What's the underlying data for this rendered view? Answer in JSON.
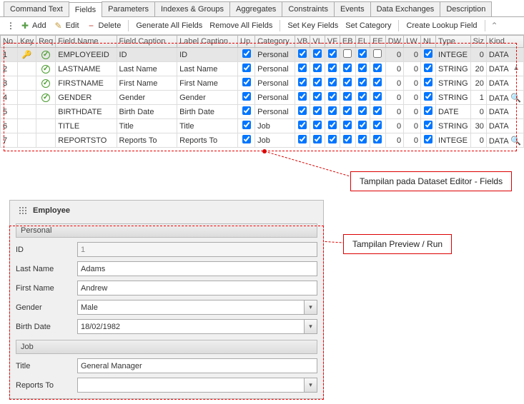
{
  "tabs": [
    "Command Text",
    "Fields",
    "Parameters",
    "Indexes & Groups",
    "Aggregates",
    "Constraints",
    "Events",
    "Data Exchanges",
    "Description"
  ],
  "active_tab": 1,
  "toolbar": {
    "add": "Add",
    "edit": "Edit",
    "delete": "Delete",
    "gen_all": "Generate All Fields",
    "rem_all": "Remove All Fields",
    "set_key": "Set Key Fields",
    "set_cat": "Set Category",
    "lookup": "Create Lookup Field"
  },
  "headers": [
    "No.",
    "Key",
    "Req",
    "Field Name",
    "Field Caption",
    "Label Caption",
    "Up.",
    "Category",
    "VB",
    "VL",
    "VF",
    "EB",
    "EL",
    "EE",
    "DW",
    "LW",
    "NL",
    "Type",
    "Siz",
    "Kind"
  ],
  "rows": [
    {
      "no": "1",
      "key": true,
      "req": true,
      "name": "EMPLOYEEID",
      "fcap": "ID",
      "lcap": "ID",
      "up": true,
      "cat": "Personal",
      "vb": true,
      "vl": true,
      "vf": true,
      "eb": false,
      "el": true,
      "ee": false,
      "dw": "0",
      "lw": "0",
      "nl": true,
      "type": "INTEGE",
      "siz": "0",
      "kind": "DATA",
      "sel": true
    },
    {
      "no": "2",
      "key": false,
      "req": true,
      "name": "LASTNAME",
      "fcap": "Last Name",
      "lcap": "Last Name",
      "up": true,
      "cat": "Personal",
      "vb": true,
      "vl": true,
      "vf": true,
      "eb": true,
      "el": true,
      "ee": true,
      "dw": "0",
      "lw": "0",
      "nl": true,
      "type": "STRING",
      "siz": "20",
      "kind": "DATA"
    },
    {
      "no": "3",
      "key": false,
      "req": true,
      "name": "FIRSTNAME",
      "fcap": "First Name",
      "lcap": "First Name",
      "up": true,
      "cat": "Personal",
      "vb": true,
      "vl": true,
      "vf": true,
      "eb": true,
      "el": true,
      "ee": true,
      "dw": "0",
      "lw": "0",
      "nl": true,
      "type": "STRING",
      "siz": "20",
      "kind": "DATA"
    },
    {
      "no": "4",
      "key": false,
      "req": true,
      "name": "GENDER",
      "fcap": "Gender",
      "lcap": "Gender",
      "up": true,
      "cat": "Personal",
      "vb": true,
      "vl": true,
      "vf": true,
      "eb": true,
      "el": true,
      "ee": true,
      "dw": "0",
      "lw": "0",
      "nl": true,
      "type": "STRING",
      "siz": "1",
      "kind": "DATA",
      "lookup": true
    },
    {
      "no": "5",
      "key": false,
      "req": false,
      "name": "BIRTHDATE",
      "fcap": "Birth Date",
      "lcap": "Birth Date",
      "up": true,
      "cat": "Personal",
      "vb": true,
      "vl": true,
      "vf": true,
      "eb": true,
      "el": true,
      "ee": true,
      "dw": "0",
      "lw": "0",
      "nl": true,
      "type": "DATE",
      "siz": "0",
      "kind": "DATA"
    },
    {
      "no": "6",
      "key": false,
      "req": false,
      "name": "TITLE",
      "fcap": "Title",
      "lcap": "Title",
      "up": true,
      "cat": "Job",
      "vb": true,
      "vl": true,
      "vf": true,
      "eb": true,
      "el": true,
      "ee": true,
      "dw": "0",
      "lw": "0",
      "nl": true,
      "type": "STRING",
      "siz": "30",
      "kind": "DATA"
    },
    {
      "no": "7",
      "key": false,
      "req": false,
      "name": "REPORTSTO",
      "fcap": "Reports To",
      "lcap": "Reports To",
      "up": true,
      "cat": "Job",
      "vb": true,
      "vl": true,
      "vf": true,
      "eb": true,
      "el": true,
      "ee": true,
      "dw": "0",
      "lw": "0",
      "nl": true,
      "type": "INTEGE",
      "siz": "0",
      "kind": "DATA",
      "lookup": true
    }
  ],
  "callout1": "Tampilan pada Dataset Editor - Fields",
  "callout2": "Tampilan Preview / Run",
  "form": {
    "title": "Employee",
    "sect1": "Personal",
    "sect2": "Job",
    "f_id": "ID",
    "v_id": "1",
    "f_ln": "Last Name",
    "v_ln": "Adams",
    "f_fn": "First Name",
    "v_fn": "Andrew",
    "f_gn": "Gender",
    "v_gn": "Male",
    "f_bd": "Birth Date",
    "v_bd": "18/02/1982",
    "f_ti": "Title",
    "v_ti": "General Manager",
    "f_rt": "Reports To",
    "v_rt": ""
  }
}
